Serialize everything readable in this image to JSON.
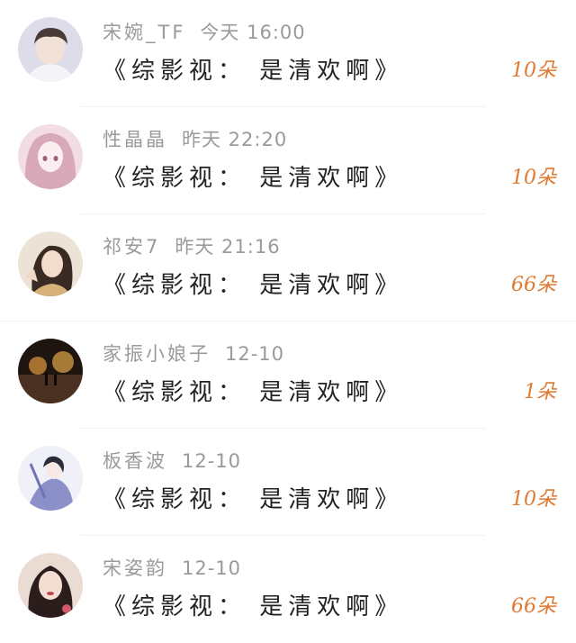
{
  "gift_list": {
    "items": [
      {
        "username": "宋婉_TF",
        "time": "今天 16:00",
        "title": "《综影视： 是清欢啊》",
        "count": "10朵",
        "avatar_icon": "avatar-young-man-icon",
        "avatar_colors": [
          "#d9dbe6",
          "#5a4a4a"
        ]
      },
      {
        "username": "性晶晶",
        "time": "昨天 22:20",
        "title": "《综影视： 是清欢啊》",
        "count": "10朵",
        "avatar_icon": "avatar-anime-girl-pink-icon",
        "avatar_colors": [
          "#f1d2dc",
          "#c98fa3"
        ]
      },
      {
        "username": "祁安7",
        "time": "昨天 21:16",
        "title": "《综影视： 是清欢啊》",
        "count": "66朵",
        "avatar_icon": "avatar-girl-photo-icon",
        "avatar_colors": [
          "#e9ddcc",
          "#3a2a24"
        ]
      },
      {
        "username": "家振小娘子",
        "time": "12-10",
        "title": "《综影视： 是清欢啊》",
        "count": "1朵",
        "avatar_icon": "avatar-night-street-icon",
        "avatar_colors": [
          "#2a1e16",
          "#c98a3a"
        ]
      },
      {
        "username": "板香波",
        "time": "12-10",
        "title": "《综影视： 是清欢啊》",
        "count": "10朵",
        "avatar_icon": "avatar-anime-swordsman-icon",
        "avatar_colors": [
          "#eef0f7",
          "#6f74b5"
        ]
      },
      {
        "username": "宋姿韵",
        "time": "12-10",
        "title": "《综影视： 是清欢啊》",
        "count": "66朵",
        "avatar_icon": "avatar-girl-portrait-icon",
        "avatar_colors": [
          "#e6cfc5",
          "#2b1d1c"
        ]
      }
    ]
  },
  "colors": {
    "accent_count": "#e07a32",
    "meta_text": "#9a9a9a",
    "title_text": "#222222",
    "divider": "#f2f2f2"
  }
}
